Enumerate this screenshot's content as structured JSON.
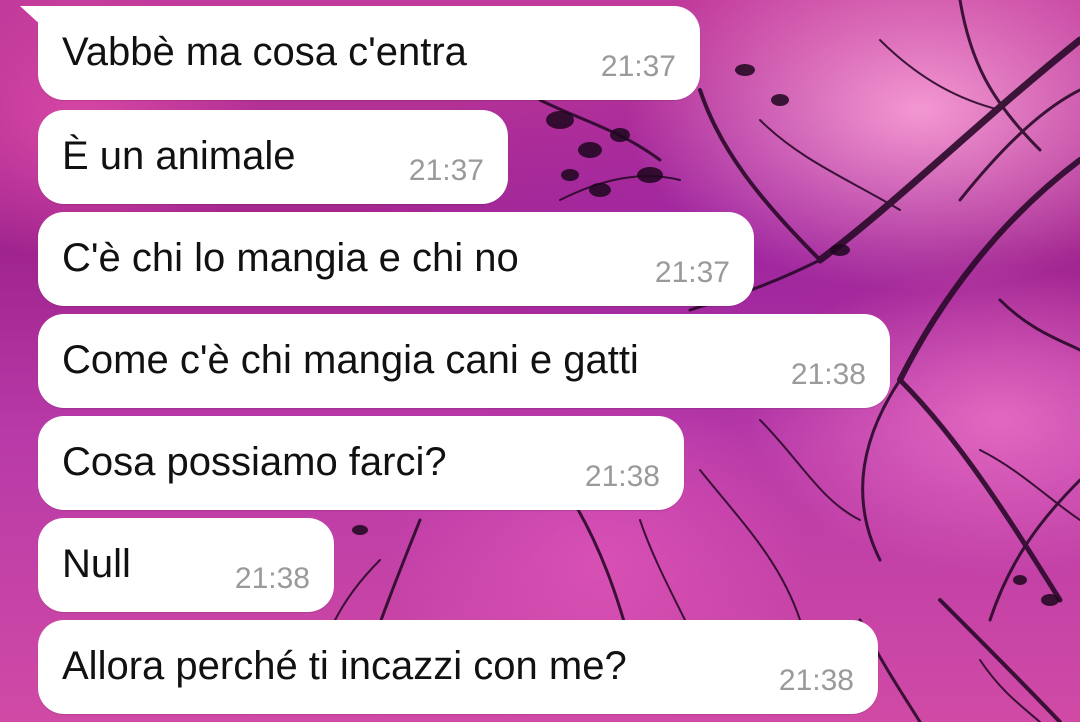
{
  "colors": {
    "bubble": "#ffffff",
    "text": "#111111",
    "timestamp": "#9a9a9a",
    "wallpaper_primary": "#a0248f",
    "wallpaper_highlight": "#e070c0"
  },
  "messages": [
    {
      "text": "Vabbè ma cosa c'entra",
      "time": "21:37"
    },
    {
      "text": "È un animale",
      "time": "21:37"
    },
    {
      "text": "C'è chi lo mangia e chi no",
      "time": "21:37"
    },
    {
      "text": "Come c'è chi mangia cani e gatti",
      "time": "21:38"
    },
    {
      "text": "Cosa possiamo farci?",
      "time": "21:38"
    },
    {
      "text": "Null",
      "time": "21:38"
    },
    {
      "text": "Allora perché ti incazzi con me?",
      "time": "21:38"
    }
  ]
}
